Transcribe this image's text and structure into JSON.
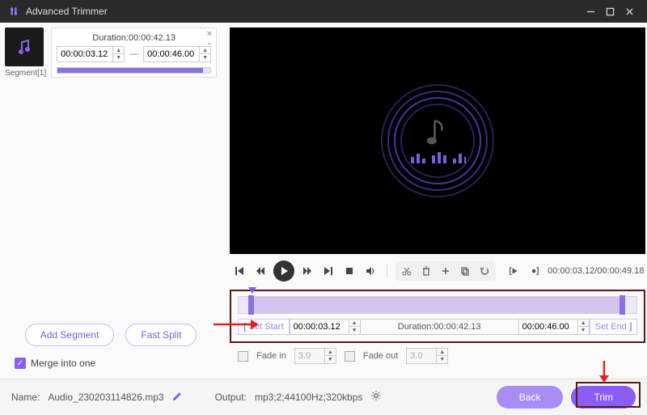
{
  "window": {
    "title": "Advanced Trimmer"
  },
  "segment": {
    "label": "Segment[1]",
    "duration_label": "Duration:00:00:42.13",
    "start": "00:00:03.12",
    "end": "00:00:46.00"
  },
  "player": {
    "timecode": "00:00:03.12/00:00:49.18"
  },
  "timeline": {
    "set_start_label": "Set Start",
    "set_end_label": "Set End",
    "start": "00:00:03.12",
    "end": "00:00:46.00",
    "duration_label": "Duration:00:00:42.13"
  },
  "fade": {
    "in_label": "Fade in",
    "in_value": "3.0",
    "out_label": "Fade out",
    "out_value": "3.0"
  },
  "left_actions": {
    "add_segment": "Add Segment",
    "fast_split": "Fast Split",
    "merge_label": "Merge into one"
  },
  "footer": {
    "name_label": "Name:",
    "name_value": "Audio_230203114826.mp3",
    "output_label": "Output:",
    "output_value": "mp3;2;44100Hz;320kbps",
    "back": "Back",
    "trim": "Trim"
  },
  "colors": {
    "accent": "#8a5ef5"
  }
}
